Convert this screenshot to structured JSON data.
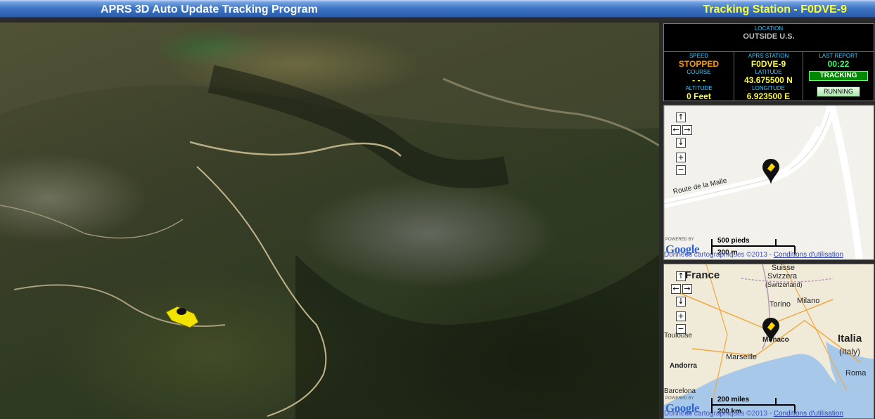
{
  "header": {
    "app_title": "APRS 3D Auto Update Tracking Program",
    "station_title": "Tracking Station - F0DVE-9"
  },
  "info": {
    "location_label": "LOCATION",
    "location_value": "OUTSIDE U.S.",
    "speed_label": "SPEED",
    "speed_value": "STOPPED",
    "course_label": "COURSE",
    "course_value": "- - -",
    "altitude_label": "ALTITUDE",
    "altitude_value": "0 Feet",
    "station_label": "APRS STATION",
    "station_value": "F0DVE-9",
    "latitude_label": "LATITUDE",
    "latitude_value": "43.675500 N",
    "longitude_label": "LONGITUDE",
    "longitude_value": "6.923500 E",
    "last_report_label": "LAST REPORT",
    "last_report_value": "00:22",
    "tracking_badge": "TRACKING",
    "running_button": "RUNNING"
  },
  "street_map": {
    "road_label": "Route de la Malle",
    "powered_by": "POWERED BY",
    "google": "Google",
    "scale_imperial": "500 pieds",
    "scale_metric": "200 m",
    "credits_prefix": "Données cartographiques ©2013",
    "credits_link": "Conditions d'utilisation"
  },
  "region_map": {
    "labels": {
      "france": "France",
      "suisse": "Suisse",
      "svizzera": "Svizzera",
      "switzerland": "(Switzerland)",
      "torino": "Torino",
      "milano": "Milano",
      "monaco": "Monaco",
      "toulouse": "Toulouse",
      "marseille": "Marseille",
      "andorra": "Andorra",
      "italia": "Italia",
      "italy": "(Italy)",
      "roma": "Roma",
      "barcelona": "Barcelona"
    },
    "powered_by": "POWERED BY",
    "google": "Google",
    "scale_imperial": "200 miles",
    "scale_metric": "200 km",
    "credits_prefix": "Données cartographiques ©2013",
    "credits_link": "Conditions d'utilisation"
  },
  "nav": {
    "up": "↑",
    "left": "←",
    "right": "→",
    "down": "↓",
    "zoom_in": "+",
    "zoom_out": "−"
  }
}
